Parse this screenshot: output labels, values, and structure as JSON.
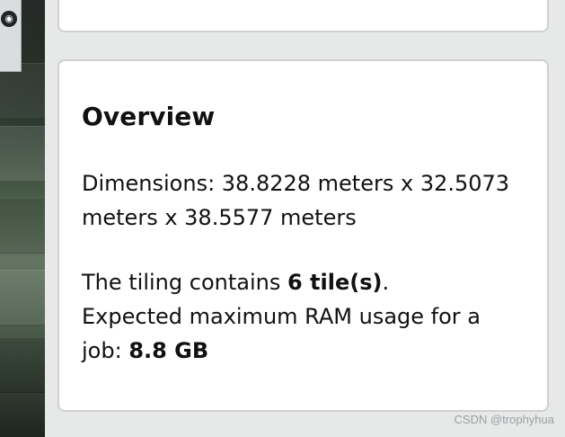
{
  "overview": {
    "title": "Overview",
    "dimensions_line": "Dimensions: 38.8228 meters x 32.5073 meters x 38.5577 meters",
    "tiling_prefix": "The tiling contains ",
    "tiling_value": "6 tile(s)",
    "tiling_suffix": ".",
    "ram_prefix": "Expected maximum RAM usage for a job: ",
    "ram_value": "8.8 GB"
  },
  "viewport": {
    "control_icon": "compass-icon"
  },
  "watermark": "CSDN @trophyhua"
}
